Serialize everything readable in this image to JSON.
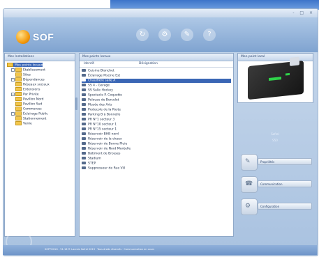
{
  "window": {
    "title_buttons": "- □ ×"
  },
  "app": {
    "logo_text": "SOF"
  },
  "toolbar": {
    "icons": [
      "refresh-icon",
      "settings-icon",
      "tools-icon",
      "help-icon"
    ]
  },
  "tree_panel": {
    "header": "Mes Installations",
    "items": [
      {
        "label": "Mes points locaux",
        "level": 0,
        "selected": true
      },
      {
        "label": "Établissement",
        "level": 1
      },
      {
        "label": "Sites",
        "level": 2
      },
      {
        "label": "Dépendances",
        "level": 1
      },
      {
        "label": "Réseaux sociaux",
        "level": 2
      },
      {
        "label": "Extensions",
        "level": 2
      },
      {
        "label": "Par Privée",
        "level": 1
      },
      {
        "label": "Pavillon Nord",
        "level": 2
      },
      {
        "label": "Pavillon Sud",
        "level": 2
      },
      {
        "label": "Commerces",
        "level": 2
      },
      {
        "label": "Éclairage Public",
        "level": 1
      },
      {
        "label": "Stationnement",
        "level": 2
      },
      {
        "label": "Voirie",
        "level": 2
      }
    ]
  },
  "list_panel": {
    "header": "Mes points locaux",
    "columns": [
      "Identif.",
      "Désignation"
    ],
    "rows": [
      "Cuisine Blanchet",
      "Éclairage Piscine Est",
      "Chaudière salle A",
      "SS 4 - Garage",
      "SS Salle Hockey",
      "Spectacle P. Coquette",
      "Pelouse de Bercelet",
      "Musée des Arts",
      "Protocole de la Poste",
      "Parking B à Bonnelle",
      "PR N°1 secteur 3",
      "PR N°10 secteur 1",
      "PR N°15 secteur 1",
      "Réservoir BHB nord",
      "Réservoir de la chaux",
      "Réservoir de Bonne Pluie",
      "Réservoir de Nord Montelle",
      "Bâtiment de Brosses",
      "Stadium",
      "STEP",
      "Suppresseur de Rue Vill"
    ],
    "selected_index": 2
  },
  "device_panel": {
    "header": "Mon point local"
  },
  "side_info": {
    "line1": "Sofrel",
    "line2": "S50"
  },
  "actions": [
    {
      "label": "Propriétés",
      "icon": "properties-icon"
    },
    {
      "label": "Communication",
      "icon": "phone-icon"
    },
    {
      "label": "Configuration",
      "icon": "config-icon"
    }
  ],
  "status": {
    "text": "SOFTOOLS - V1.16  © Lacroix Sofrel 2013 · Tous droits réservés · Communication en cours"
  }
}
